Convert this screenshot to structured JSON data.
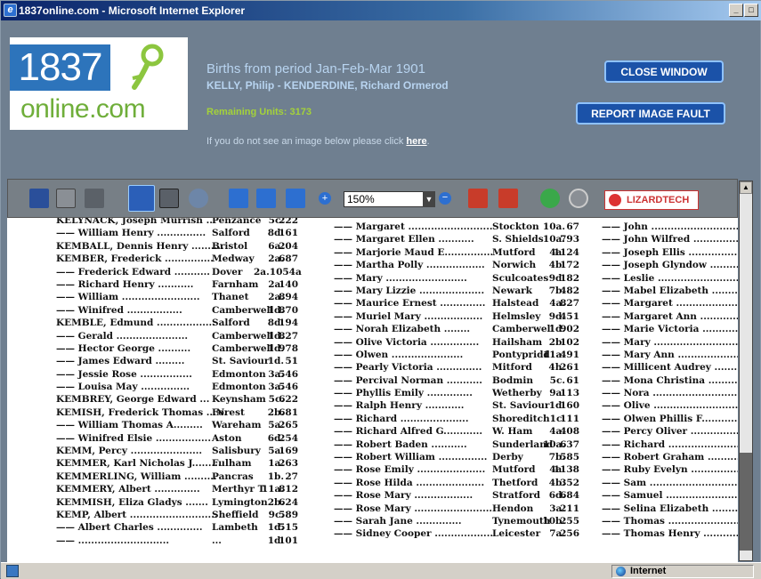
{
  "window": {
    "title": "1837online.com - Microsoft Internet Explorer",
    "min": "_",
    "max": "□",
    "close": "×"
  },
  "logo": {
    "number": "1837",
    "domain": "online.com"
  },
  "header": {
    "period_title": "Births from period Jan-Feb-Mar 1901",
    "range": "KELLY, Philip - KENDERDINE, Richard Ormerod",
    "units": "Remaining Units: 3173",
    "notice_prefix": "If you do not see an image below please click ",
    "notice_link": "here",
    "notice_suffix": ".",
    "close_button": "CLOSE WINDOW",
    "report_button": "REPORT IMAGE FAULT"
  },
  "toolbar": {
    "zoom_value": "150%",
    "icons": [
      "save-icon",
      "print-icon",
      "binoculars-icon",
      "hand-icon",
      "text-select-icon",
      "zoom-icon",
      "page-first-icon",
      "page-fit-icon",
      "page-last-icon",
      "zoom-in-icon",
      "zoom-out-icon",
      "rotate-left-icon",
      "rotate-right-icon",
      "go-icon",
      "stop-icon"
    ],
    "brand": "LIZARDTECH"
  },
  "index": {
    "col1": [
      {
        "n": "KELYNACK, Joseph Murrish ...",
        "p": "Penzance",
        "d": "5c.",
        "pg": "222"
      },
      {
        "n": "—— William Henry ...............",
        "p": "Salford",
        "d": "8d.",
        "pg": "161"
      },
      {
        "n": "KEMBALL, Dennis Henry ..........",
        "p": "Bristol",
        "d": "6a.",
        "pg": "204"
      },
      {
        "n": "KEMBER, Frederick ...............",
        "p": "Medway",
        "d": "2a.",
        "pg": "687"
      },
      {
        "n": "—— Frederick Edward ...........",
        "p": "Dover",
        "d": "2a.1054a",
        "pg": ""
      },
      {
        "n": "—— Richard Henry ...........",
        "p": "Farnham",
        "d": "2a.",
        "pg": "140"
      },
      {
        "n": "—— William ........................",
        "p": "Thanet",
        "d": "2a.",
        "pg": "894"
      },
      {
        "n": "—— Winifred .................",
        "p": "Camberwell",
        "d": "1d.",
        "pg": "870"
      },
      {
        "n": "KEMBLE, Edmund ..................",
        "p": "Salford",
        "d": "8d.",
        "pg": "194"
      },
      {
        "n": "—— Gerald ......................",
        "p": "Camberwell",
        "d": "1d.",
        "pg": "827"
      },
      {
        "n": "—— Hector George ..........",
        "p": "Camberwell",
        "d": "1d.",
        "pg": "978"
      },
      {
        "n": "—— James Edward .........",
        "p": "St. Saviour",
        "d": "1d.",
        "pg": "51"
      },
      {
        "n": "—— Jessie Rose ................",
        "p": "Edmonton",
        "d": "3a.",
        "pg": "546"
      },
      {
        "n": "—— Louisa May ...............",
        "p": "Edmonton",
        "d": "3a.",
        "pg": "546"
      },
      {
        "n": "KEMBREY, George Edward ...",
        "p": "Keynsham",
        "d": "5c.",
        "pg": "622"
      },
      {
        "n": "KEMISH, Frederick Thomas ...N.",
        "p": "Forest",
        "d": "2b.",
        "pg": "681"
      },
      {
        "n": "—— William Thomas A.........",
        "p": "Wareham",
        "d": "5a.",
        "pg": "265"
      },
      {
        "n": "—— Winifred Elsie .................",
        "p": "Aston",
        "d": "6d.",
        "pg": "254"
      },
      {
        "n": "KEMM, Percy ......................",
        "p": "Salisbury",
        "d": "5a.",
        "pg": "169"
      },
      {
        "n": "KEMMER, Karl Nicholas J.........",
        "p": "Fulham",
        "d": "1a.",
        "pg": "263"
      },
      {
        "n": "KEMMERLING, William ..........",
        "p": "Pancras",
        "d": "1b.",
        "pg": "27"
      },
      {
        "n": "KEMMERY, Albert ..............",
        "p": "Merthyr T.",
        "d": "11a.",
        "pg": "812"
      },
      {
        "n": "KEMMISH, Eliza Gladys .......",
        "p": "Lymington",
        "d": "2b.",
        "pg": "624"
      },
      {
        "n": "KEMP, Albert ...........................",
        "p": "Sheffield",
        "d": "9c.",
        "pg": "589"
      },
      {
        "n": "—— Albert Charles ..............",
        "p": "Lambeth",
        "d": "1d.",
        "pg": "515"
      },
      {
        "n": "—— ............................",
        "p": "...",
        "d": "1d.",
        "pg": "101"
      }
    ],
    "col2": [
      {
        "n": "—— Margaret ..........................",
        "p": "Stockton",
        "d": "10a.",
        "pg": "67"
      },
      {
        "n": "—— Margaret Ellen ...........",
        "p": "S. Shields",
        "d": "10a.",
        "pg": "793"
      },
      {
        "n": "—— Marjorie Maud E...............",
        "p": "Mutford",
        "d": "4a.",
        "pg": "1124"
      },
      {
        "n": "—— Martha Polly ..................",
        "p": "Norwich",
        "d": "4b.",
        "pg": "172"
      },
      {
        "n": "—— Mary .........................",
        "p": "Sculcoates",
        "d": "9d.",
        "pg": "182"
      },
      {
        "n": "—— Mary Lizzie ....................",
        "p": "Newark",
        "d": "7b.",
        "pg": "482"
      },
      {
        "n": "—— Maurice Ernest ..............",
        "p": "Halstead",
        "d": "4a.",
        "pg": "827"
      },
      {
        "n": "—— Muriel Mary ..................",
        "p": "Helmsley",
        "d": "9d.",
        "pg": "451"
      },
      {
        "n": "—— Norah Elizabeth ........",
        "p": "Camberwell",
        "d": "1d.",
        "pg": "902"
      },
      {
        "n": "—— Olive Victoria ...............",
        "p": "Hailsham",
        "d": "2b.",
        "pg": "102"
      },
      {
        "n": "—— Olwen ......................",
        "p": "Pontypridd",
        "d": "11a.",
        "pg": "491"
      },
      {
        "n": "—— Pearly Victoria ..............",
        "p": "Mitford",
        "d": "4h.",
        "pg": "261"
      },
      {
        "n": "—— Percival Norman ...........",
        "p": "Bodmin",
        "d": "5c.",
        "pg": "61"
      },
      {
        "n": "—— Phyllis Emily ..............",
        "p": "Wetherby",
        "d": "9a.",
        "pg": "113"
      },
      {
        "n": "—— Ralph Henry ............",
        "p": "St. Saviour",
        "d": "1d.",
        "pg": "160"
      },
      {
        "n": "—— Richard .....................",
        "p": "Shoreditch",
        "d": "1c.",
        "pg": "111"
      },
      {
        "n": "—— Richard Alfred G............",
        "p": "W. Ham",
        "d": "4a.",
        "pg": "408"
      },
      {
        "n": "—— Robert Baden ...........",
        "p": "Sunderland",
        "d": "10a.",
        "pg": "637"
      },
      {
        "n": "—— Robert William ...............",
        "p": "Derby",
        "d": "7b.",
        "pg": "585"
      },
      {
        "n": "—— Rose Emily .....................",
        "p": "Mutford",
        "d": "4a.",
        "pg": "1138"
      },
      {
        "n": "—— Rose Hilda .....................",
        "p": "Thetford",
        "d": "4b.",
        "pg": "352"
      },
      {
        "n": "—— Rose Mary ..................",
        "p": "Stratford",
        "d": "6d.",
        "pg": "684"
      },
      {
        "n": "—— Rose Mary ........................",
        "p": "Hendon",
        "d": "3a.",
        "pg": "211"
      },
      {
        "n": "—— Sarah Jane ..............",
        "p": "Tynemouth",
        "d": "10b.",
        "pg": "255"
      },
      {
        "n": "—— Sidney Cooper ..................",
        "p": "Leicester",
        "d": "7a.",
        "pg": "256"
      }
    ],
    "col3": [
      "—— John ............................",
      "—— John Wilfred ...................",
      "—— Joseph Ellis ....................",
      "—— Joseph Glyndow .........",
      "—— Leslie ............................",
      "—— Mabel Elizabeth ...........",
      "—— Margaret ........................",
      "—— Margaret Ann ..............",
      "—— Marie Victoria .............",
      "—— Mary ..............................",
      "—— Mary Ann .......................",
      "—— Millicent Audrey ..........",
      "—— Mona Christina ............",
      "—— Nora ..............................",
      "—— Olive ...............................",
      "—— Olwen Phillis F...............",
      "—— Percy Oliver ..................",
      "—— Richard ...........................",
      "—— Robert Graham ...............",
      "—— Ruby Evelyn ..................",
      "—— Sam .................................",
      "—— Samuel ............................",
      "—— Selina Elizabeth ..........",
      "—— Thomas ...........................",
      "—— Thomas Henry .............."
    ]
  },
  "status": {
    "zone": "Internet"
  }
}
